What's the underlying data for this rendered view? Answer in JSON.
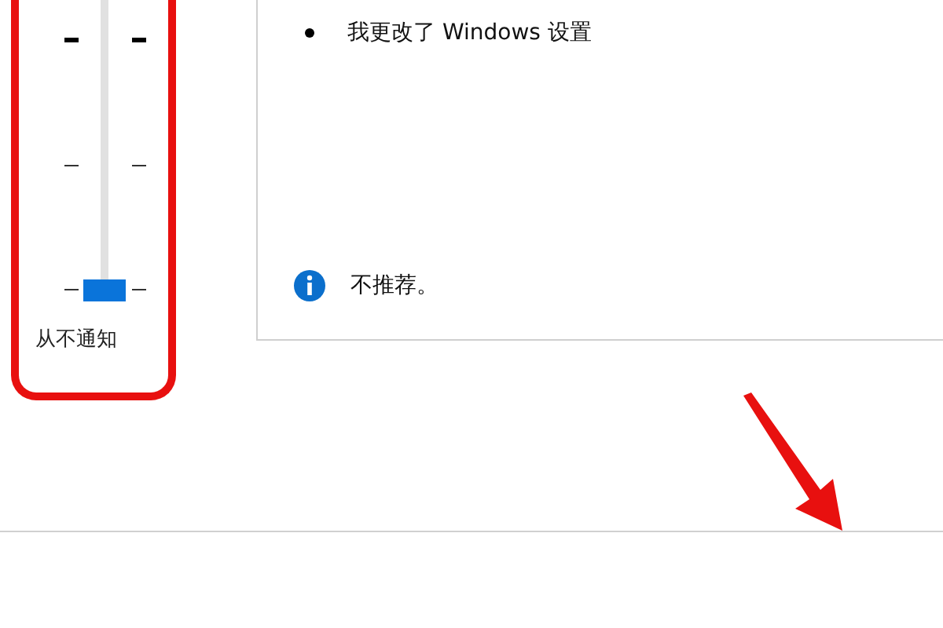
{
  "slider": {
    "level": 0,
    "label": "从不通知"
  },
  "panel": {
    "bullets": [
      {
        "text": "我更改了 Windows 设置"
      }
    ],
    "note": {
      "kind": "info",
      "text": "不推荐。"
    }
  }
}
